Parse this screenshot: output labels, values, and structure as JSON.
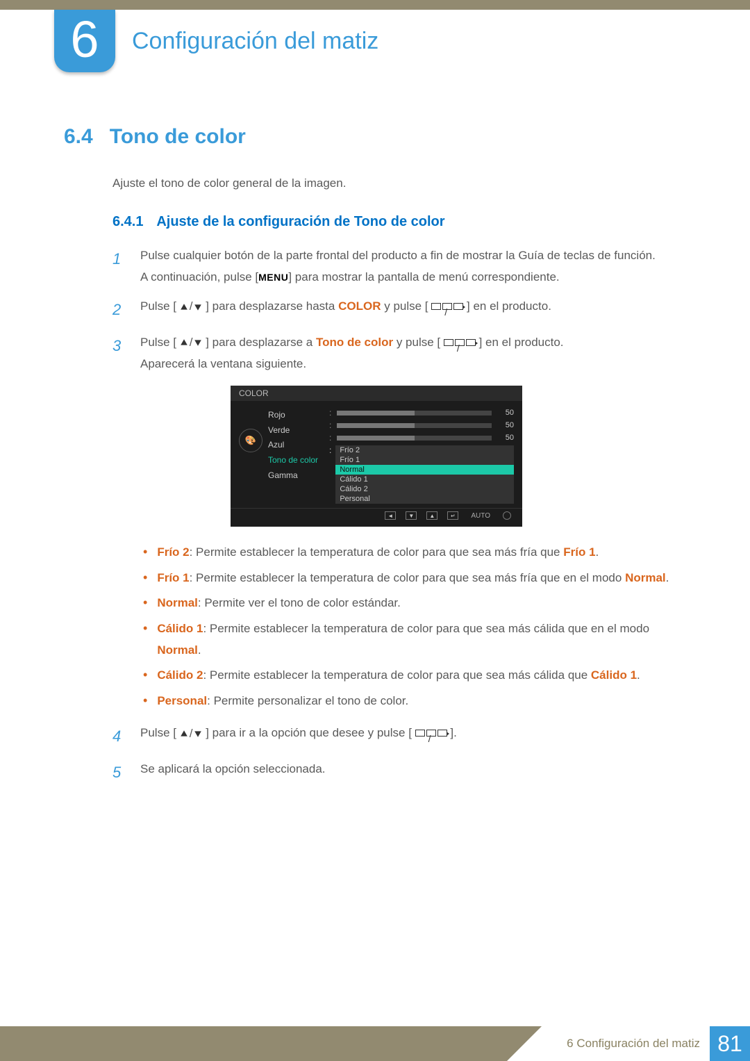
{
  "chapter": {
    "number": "6",
    "title": "Configuración del matiz"
  },
  "section": {
    "number": "6.4",
    "title": "Tono de color"
  },
  "intro": "Ajuste el tono de color general de la imagen.",
  "subsection": {
    "number": "6.4.1",
    "title": "Ajuste de la configuración de Tono de color"
  },
  "steps": {
    "s1a": "Pulse cualquier botón de la parte frontal del producto a fin de mostrar la Guía de teclas de función.",
    "s1b_pre": "A continuación, pulse [",
    "s1b_menu": "MENU",
    "s1b_post": "] para mostrar la pantalla de menú correspondiente.",
    "s2_pre": "Pulse [",
    "s2_mid": "] para desplazarse hasta ",
    "s2_color": "COLOR",
    "s2_mid2": " y pulse [",
    "s2_post": "] en el producto.",
    "s3_pre": "Pulse [",
    "s3_mid": "] para desplazarse a ",
    "s3_tono": "Tono de color",
    "s3_mid2": " y pulse [",
    "s3_post": "] en el producto.",
    "s3_b": "Aparecerá la ventana siguiente.",
    "s4_pre": "Pulse [",
    "s4_mid": "] para ir a la opción que desee y pulse [",
    "s4_post": "].",
    "s5": "Se aplicará la opción seleccionada."
  },
  "osd": {
    "title": "COLOR",
    "labels": {
      "rojo": "Rojo",
      "verde": "Verde",
      "azul": "Azul",
      "tono": "Tono de color",
      "gamma": "Gamma"
    },
    "values": {
      "rojo": "50",
      "verde": "50",
      "azul": "50"
    },
    "options": {
      "frio2": "Frío 2",
      "frio1": "Frío 1",
      "normal": "Normal",
      "calido1": "Cálido 1",
      "calido2": "Cálido 2",
      "personal": "Personal"
    },
    "auto": "AUTO"
  },
  "bullets": {
    "b1_t": "Frío 2",
    "b1": ": Permite establecer la temperatura de color para que sea más fría que ",
    "b1_t2": "Frío 1",
    "b1_end": ".",
    "b2_t": "Frío 1",
    "b2": ": Permite establecer la temperatura de color para que sea más fría que en el modo ",
    "b2_t2": "Normal",
    "b2_end": ".",
    "b3_t": "Normal",
    "b3": ": Permite ver el tono de color estándar.",
    "b4_t": "Cálido 1",
    "b4": ": Permite establecer la temperatura de color para que sea más cálida que en el modo ",
    "b4_t2": "Normal",
    "b4_end": ".",
    "b5_t": "Cálido 2",
    "b5": ": Permite establecer la temperatura de color para que sea más cálida que ",
    "b5_t2": "Cálido 1",
    "b5_end": ".",
    "b6_t": "Personal",
    "b6": ": Permite personalizar el tono de color."
  },
  "footer": {
    "label": "6 Configuración del matiz",
    "page": "81"
  }
}
